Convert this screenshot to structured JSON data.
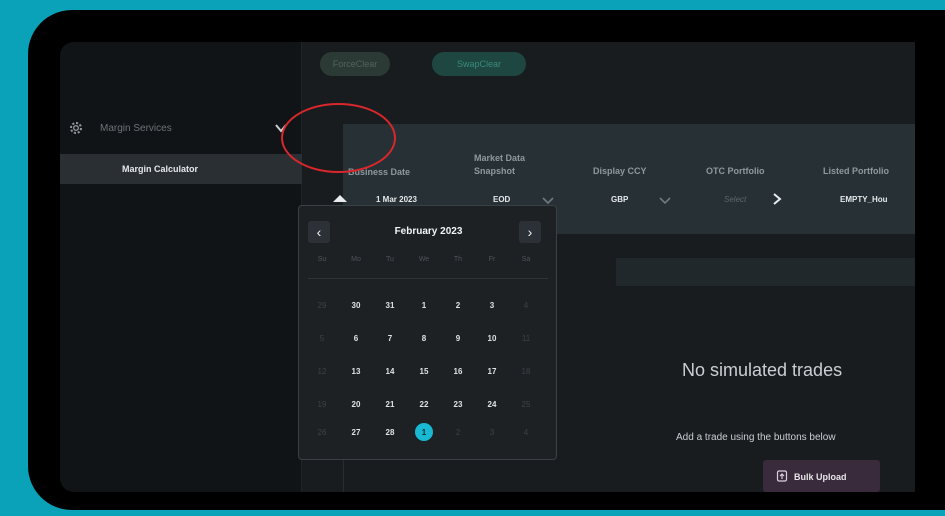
{
  "colors": {
    "background": "#0aa2b8",
    "screen": "#181c1f",
    "sidebar": "#111416",
    "param_panel": "#263035",
    "selected_day": "#19b8d3",
    "highlight_circle": "#d9272c",
    "bulk_button": "#3a2b3c"
  },
  "top_buttons": {
    "forceclear": "ForceClear",
    "swapclear": "SwapClear"
  },
  "sidebar": {
    "section_title": "Margin Services",
    "section_icon": "gear-icon",
    "item_label": "Margin Calculator"
  },
  "params": {
    "business_date": {
      "label": "Business Date",
      "value": "1 Mar 2023"
    },
    "market_data": {
      "label_line1": "Market Data",
      "label_line2": "Snapshot",
      "value": "EOD"
    },
    "display_ccy": {
      "label": "Display CCY",
      "value": "GBP"
    },
    "otc_portfolio": {
      "label": "OTC Portfolio",
      "placeholder": "Select"
    },
    "listed_portfolio": {
      "label": "Listed Portfolio",
      "value": "EMPTY_Hou"
    }
  },
  "calendar": {
    "prev_icon": "‹",
    "next_icon": "›",
    "title": "February 2023",
    "days_of_week": [
      "Su",
      "Mo",
      "Tu",
      "We",
      "Th",
      "Fr",
      "Sa"
    ],
    "weeks": [
      [
        "29",
        "30",
        "31",
        "1",
        "2",
        "3",
        "4"
      ],
      [
        "5",
        "6",
        "7",
        "8",
        "9",
        "10",
        "11"
      ],
      [
        "12",
        "13",
        "14",
        "15",
        "16",
        "17",
        "18"
      ],
      [
        "19",
        "20",
        "21",
        "22",
        "23",
        "24",
        "25"
      ],
      [
        "26",
        "27",
        "28",
        "1",
        "2",
        "3",
        "4"
      ]
    ],
    "dim_days": [
      [
        true,
        false,
        false,
        false,
        false,
        false,
        true
      ],
      [
        true,
        false,
        false,
        false,
        false,
        false,
        true
      ],
      [
        true,
        false,
        false,
        false,
        false,
        false,
        true
      ],
      [
        true,
        false,
        false,
        false,
        false,
        false,
        true
      ],
      [
        true,
        false,
        false,
        false,
        true,
        true,
        true
      ]
    ],
    "selected": {
      "week": 4,
      "day": 3
    }
  },
  "main": {
    "empty_title": "No simulated trades",
    "empty_subtitle": "Add a trade using the buttons below",
    "bulk_upload_label": "Bulk Upload",
    "bulk_upload_icon": "upload-icon"
  }
}
